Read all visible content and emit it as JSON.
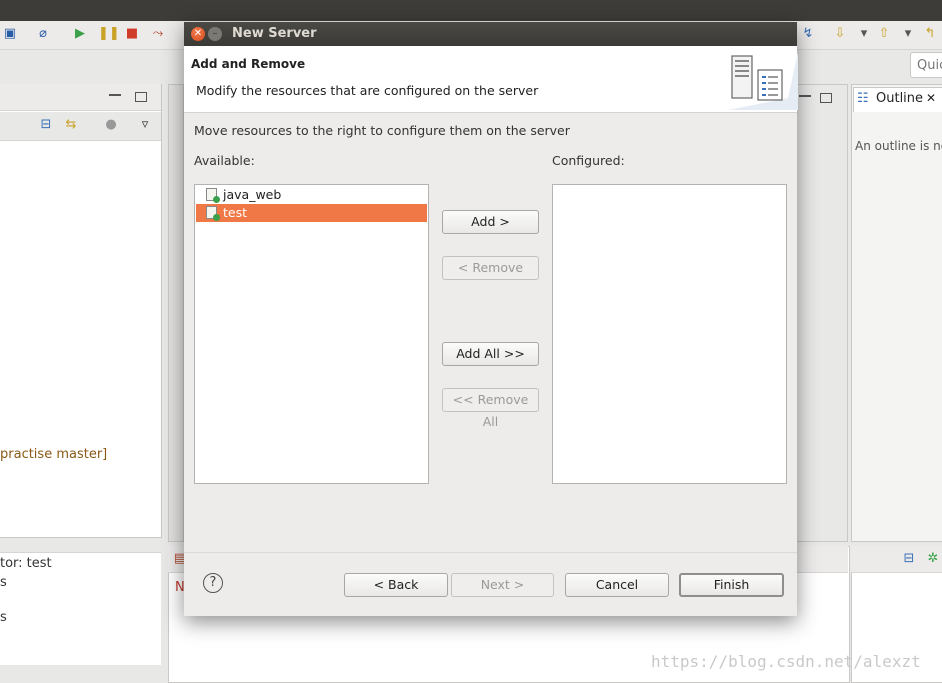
{
  "dialog": {
    "title": "New Server",
    "header_title": "Add and Remove",
    "header_description": "Modify the resources that are configured on the server",
    "instruction": "Move resources to the right to configure them on the server",
    "available_label": "Available:",
    "configured_label": "Configured:",
    "available_items": [
      {
        "label": "java_web",
        "selected": false
      },
      {
        "label": "test",
        "selected": true
      }
    ],
    "configured_items": [],
    "buttons": {
      "add": "Add >",
      "remove": "< Remove",
      "add_all": "Add All >>",
      "remove_all": "<< Remove All",
      "back": "< Back",
      "next": "Next >",
      "cancel": "Cancel",
      "finish": "Finish"
    },
    "help_glyph": "?",
    "close_glyph": "✕",
    "minimize_glyph": "–"
  },
  "background": {
    "quick_access": "Quic",
    "left_project_text": "practise master]",
    "left_bottom_line1": "tor: test",
    "left_bottom_line2": "s",
    "left_bottom_line3": "s",
    "center_bottom_text": "N",
    "outline_title": "Outline",
    "outline_close": "✕",
    "outline_message": "An outline is no"
  },
  "watermark": "https://blog.csdn.net/alexzt",
  "colors": {
    "selection": "#f07746",
    "titlebar": "#3d3c38",
    "close_button": "#e0582a"
  },
  "icons": [
    "server-graphic-icon",
    "project-icon",
    "help-icon",
    "outline-icon"
  ]
}
